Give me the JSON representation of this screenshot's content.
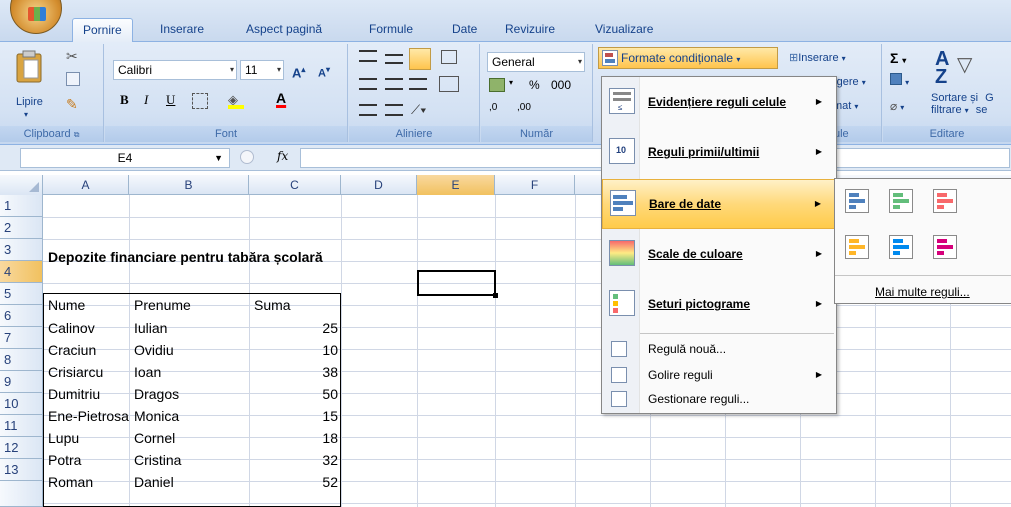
{
  "tabs": [
    {
      "label": "Pornire",
      "active": true
    },
    {
      "label": "Inserare"
    },
    {
      "label": "Aspect pagină"
    },
    {
      "label": "Formule"
    },
    {
      "label": "Date"
    },
    {
      "label": "Revizuire"
    },
    {
      "label": "Vizualizare"
    }
  ],
  "ribbon": {
    "clipboard": {
      "paste_label": "Lipire",
      "group_label": "Clipboard"
    },
    "font": {
      "font_name": "Calibri",
      "font_size": "11",
      "bold": "B",
      "italic": "I",
      "underline": "U",
      "group_label": "Font",
      "grow": "A",
      "shrink": "A",
      "font_color_letter": "A"
    },
    "alignment": {
      "group_label": "Aliniere"
    },
    "number": {
      "format": "General",
      "percent": "%",
      "thousands": "000",
      "inc_decimal": ",0",
      "dec_decimal": ",00",
      "group_label": "Număr"
    },
    "styles": {
      "conditional_formatting": "Formate condiționale"
    },
    "cells": {
      "insert": "Inserare",
      "delete_partial": "rgere",
      "format_partial": "mat",
      "group_label_partial": "ule"
    },
    "editing": {
      "sum": "Σ",
      "sort_filter_line1": "Sortare și",
      "sort_filter_line2": "filtrare",
      "find_partial_1": "G",
      "find_partial_2": "se",
      "group_label": "Editare"
    }
  },
  "formula_bar": {
    "name_box": "E4",
    "fx": "fx",
    "value": ""
  },
  "columns": [
    "A",
    "B",
    "C",
    "D",
    "E",
    "F"
  ],
  "rows": [
    "1",
    "2",
    "3",
    "4",
    "5",
    "6",
    "7",
    "8",
    "9",
    "10",
    "11",
    "12",
    "13"
  ],
  "sheet": {
    "title": "Depozite financiare pentru tabăra școlară",
    "headers": [
      "Nume",
      "Prenume",
      "Suma"
    ],
    "records": [
      [
        "Calinov",
        "Iulian",
        "25"
      ],
      [
        "Craciun",
        "Ovidiu",
        "10"
      ],
      [
        "Crisiarcu",
        "Ioan",
        "38"
      ],
      [
        "Dumitriu",
        "Dragos",
        "50"
      ],
      [
        "Ene-Pietrosa",
        "Monica",
        "15"
      ],
      [
        "Lupu",
        "Cornel",
        "18"
      ],
      [
        "Potra",
        "Cristina",
        "32"
      ],
      [
        "Roman",
        "Daniel",
        "52"
      ]
    ]
  },
  "menu": {
    "items": [
      {
        "label": "Evidențiere reguli celule",
        "has_submenu": true
      },
      {
        "label": "Reguli primii/ultimii",
        "has_submenu": true
      },
      {
        "label": "Bare de date",
        "has_submenu": true,
        "highlighted": true
      },
      {
        "label": "Scale de culoare",
        "has_submenu": true
      },
      {
        "label": "Seturi pictograme",
        "has_submenu": true
      }
    ],
    "small_items": [
      {
        "label": "Regulă nouă..."
      },
      {
        "label": "Golire reguli",
        "has_submenu": true
      },
      {
        "label": "Gestionare reguli..."
      }
    ]
  },
  "submenu": {
    "more_rules": "Mai multe reguli...",
    "bar_colors": [
      "#4f81bd",
      "#9bbb59",
      "#c0504d",
      "#f79646",
      "#4bacc6",
      "#8064a2"
    ]
  },
  "colors": {
    "highlight": "#ffd97a",
    "ribbon": "#d3e1f3",
    "accent": "#15428b"
  }
}
